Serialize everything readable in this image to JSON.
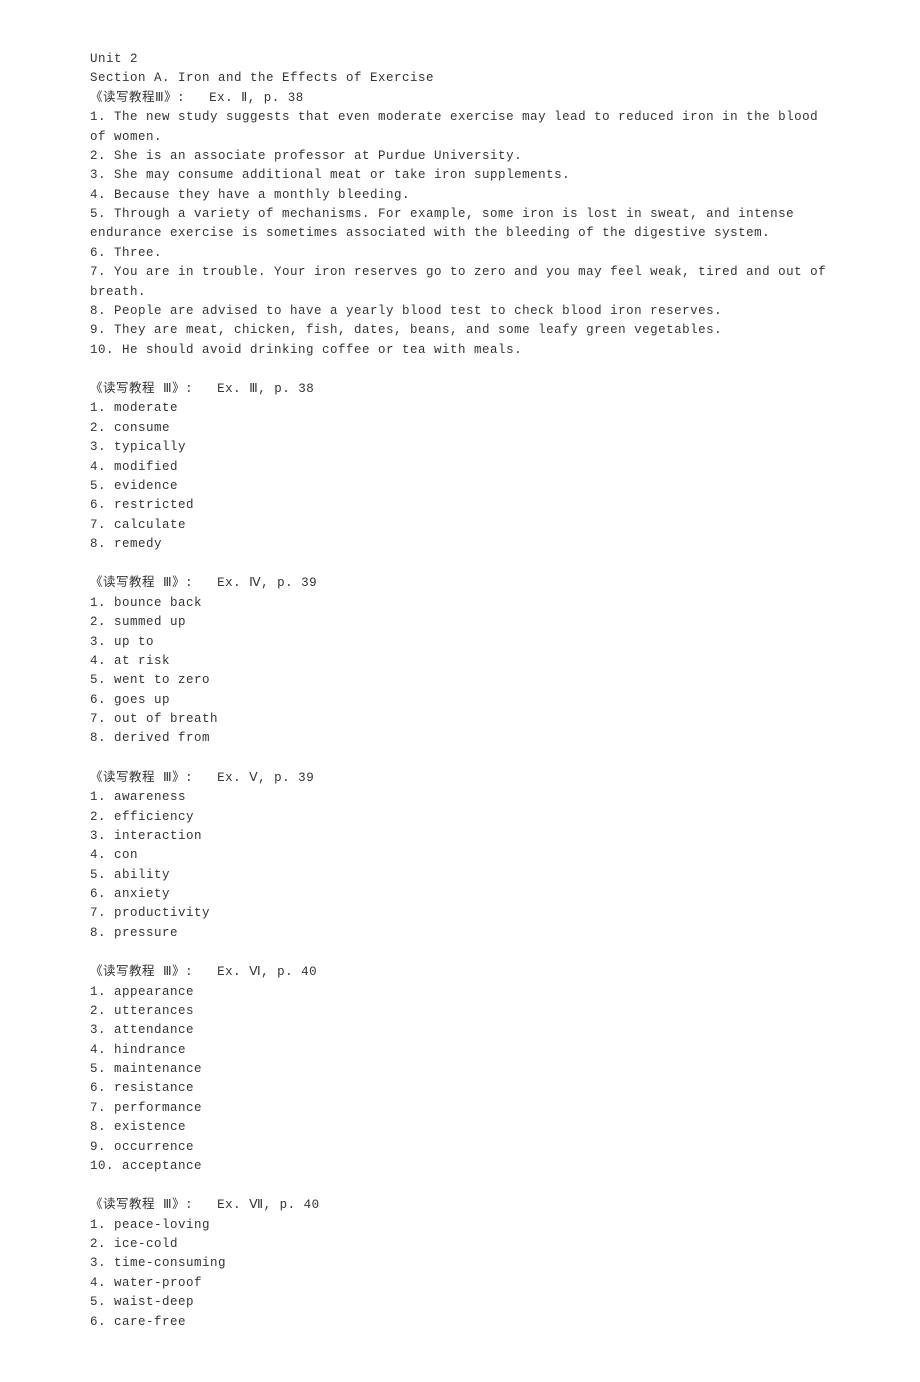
{
  "header": {
    "unit": "Unit 2",
    "section": "Section A. Iron and the Effects of Exercise"
  },
  "exercises": [
    {
      "title": "《读写教程Ⅲ》:   Ex. Ⅱ, p. 38",
      "items": [
        "1. The new study suggests that even moderate exercise may lead to reduced iron in the blood of women.",
        "2. She is an associate professor at Purdue University.",
        "3. She may consume additional meat or take iron supplements.",
        "4. Because they have a monthly bleeding.",
        "5. Through a variety of mechanisms. For example, some iron is lost in sweat, and intense endurance exercise is sometimes associated with the bleeding of the digestive system.",
        "6. Three.",
        "7. You are in trouble. Your iron reserves go to zero and you may feel weak, tired and out of breath.",
        "8. People are advised to have a yearly blood test to check blood iron reserves.",
        "9. They are meat, chicken, fish, dates, beans, and some leafy green vegetables.",
        "10. He should avoid drinking coffee or tea with meals."
      ]
    },
    {
      "title": "《读写教程 Ⅲ》:   Ex. Ⅲ, p. 38",
      "items": [
        "1. moderate",
        "2. consume",
        "3. typically",
        "4. modified",
        "5. evidence",
        "6. restricted",
        "7. calculate",
        "8. remedy"
      ]
    },
    {
      "title": "《读写教程 Ⅲ》:   Ex. Ⅳ, p. 39",
      "items": [
        "1. bounce back",
        "2. summed up",
        "3. up to",
        "4. at risk",
        "5. went to zero",
        "6. goes up",
        "7. out of breath",
        "8. derived from"
      ]
    },
    {
      "title": "《读写教程 Ⅲ》:   Ex. Ⅴ, p. 39",
      "items": [
        "1. awareness",
        "2. efficiency",
        "3. interaction",
        "4. con",
        "5. ability",
        "6. anxiety",
        "7. productivity",
        "8. pressure"
      ]
    },
    {
      "title": "《读写教程 Ⅲ》:   Ex. Ⅵ, p. 40",
      "items": [
        "1. appearance",
        "2. utterances",
        "3. attendance",
        "4. hindrance",
        "5. maintenance",
        "6. resistance",
        "7. performance",
        "8. existence",
        "9. occurrence",
        "10. acceptance"
      ]
    },
    {
      "title": "《读写教程 Ⅲ》:   Ex. Ⅶ, p. 40",
      "items": [
        "1. peace-loving",
        "2. ice-cold",
        "3. time-consuming",
        "4. water-proof",
        "5. waist-deep",
        "6. care-free"
      ]
    }
  ]
}
